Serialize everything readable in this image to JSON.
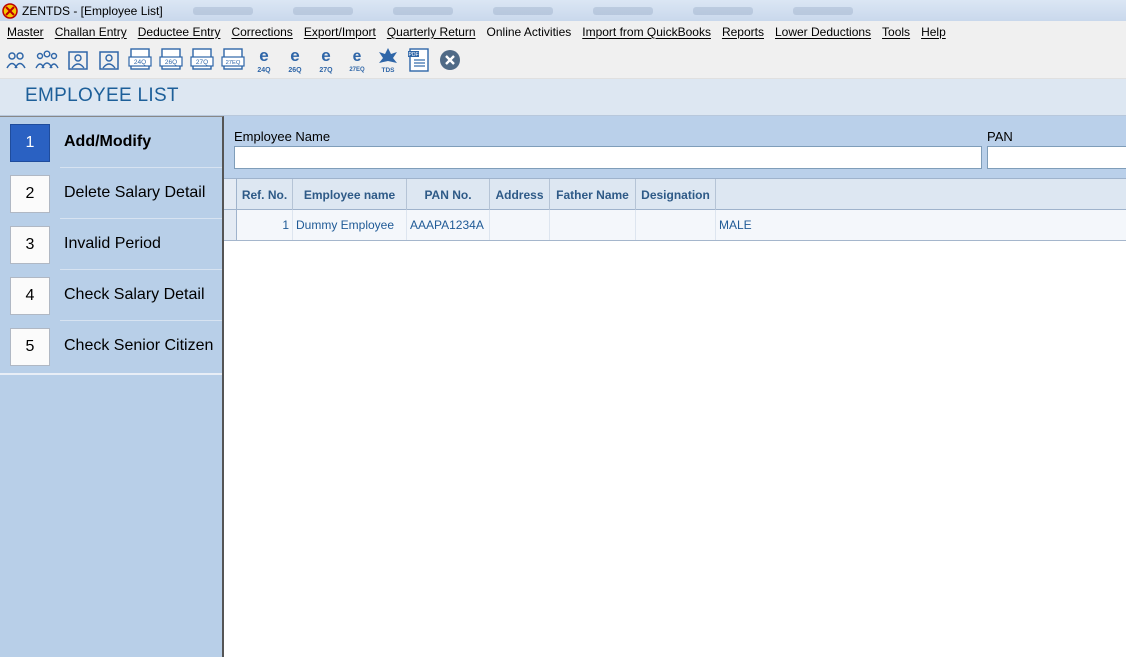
{
  "window": {
    "title": "ZENTDS - [Employee List]"
  },
  "menu": [
    "Master",
    "Challan Entry",
    "Deductee Entry",
    "Corrections",
    "Export/Import",
    "Quarterly Return",
    "Online Activities",
    "Import from QuickBooks",
    "Reports",
    "Lower Deductions",
    "Tools",
    "Help"
  ],
  "toolbar": {
    "form_24q": "24Q",
    "form_26q": "26Q",
    "form_27q": "27Q",
    "form_27eq": "27EQ",
    "e_24q": "24Q",
    "e_26q": "26Q",
    "e_27q": "27Q",
    "e_27eq": "27EQ",
    "e_letter": "e",
    "tds": "TDS",
    "pdf": "PDF"
  },
  "page": {
    "title": "EMPLOYEE LIST"
  },
  "sidebar": {
    "items": [
      {
        "num": "1",
        "label": "Add/Modify"
      },
      {
        "num": "2",
        "label": "Delete Salary Detail"
      },
      {
        "num": "3",
        "label": "Invalid Period"
      },
      {
        "num": "4",
        "label": "Check Salary Detail"
      },
      {
        "num": "5",
        "label": "Check Senior Citizen"
      }
    ]
  },
  "filter": {
    "employee_name_label": "Employee Name",
    "employee_name_value": "",
    "pan_label": "PAN",
    "pan_value": ""
  },
  "table": {
    "columns": [
      "Ref. No.",
      "Employee name",
      "PAN No.",
      "Address",
      "Father Name",
      "Designation"
    ],
    "rows": [
      {
        "ref_no": "1",
        "employee_name": "Dummy Employee",
        "pan": "AAAPA1234A",
        "address": "",
        "father_name": "",
        "designation": "",
        "gender": "MALE"
      }
    ]
  },
  "colors": {
    "accent": "#2a61c2",
    "title_text": "#1d5f99",
    "sidebar_bg": "#b8cfe8",
    "grid_text": "#1f5a96"
  }
}
